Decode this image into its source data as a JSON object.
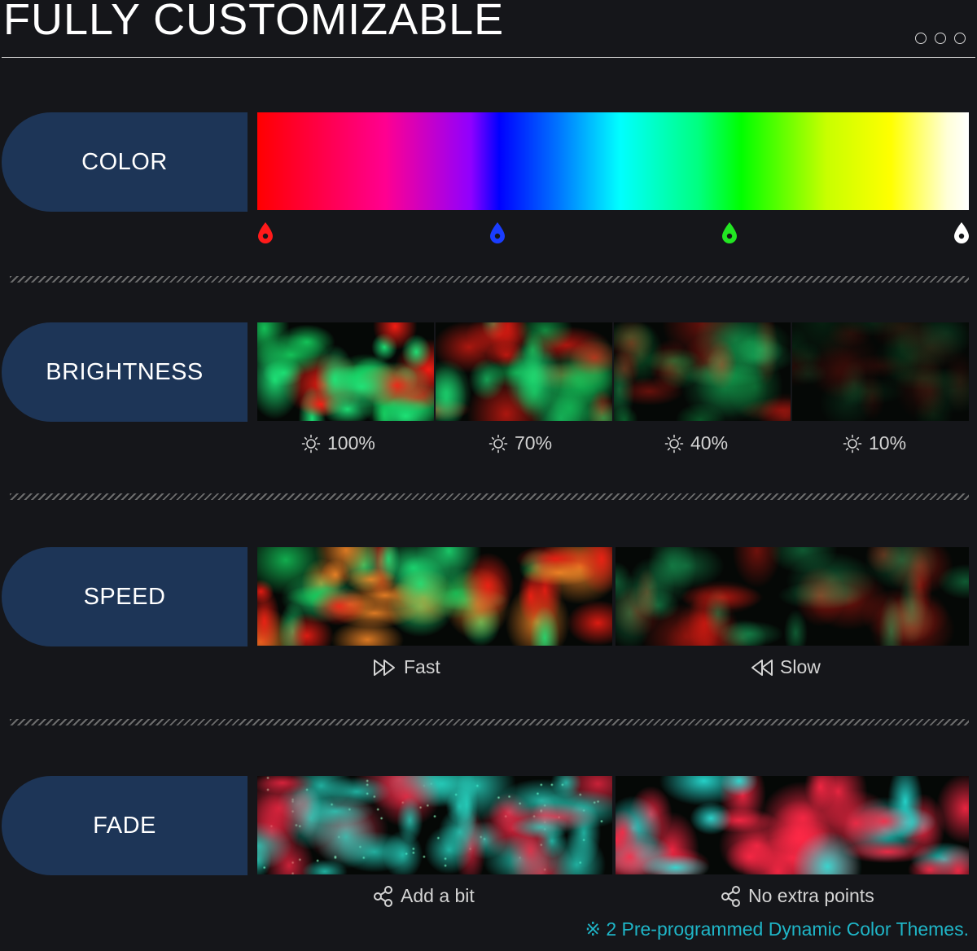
{
  "header": {
    "title": "FULLY CUSTOMIZABLE"
  },
  "sections": {
    "color": {
      "label": "COLOR",
      "drops": [
        {
          "color": "#ff1a1a"
        },
        {
          "color": "#1a3dff"
        },
        {
          "color": "#22e622"
        },
        {
          "color": "#ffffff"
        }
      ]
    },
    "brightness": {
      "label": "BRIGHTNESS",
      "levels": [
        {
          "label": "100%",
          "level": 1.0
        },
        {
          "label": "70%",
          "level": 0.7
        },
        {
          "label": "40%",
          "level": 0.4
        },
        {
          "label": "10%",
          "level": 0.1
        }
      ]
    },
    "speed": {
      "label": "SPEED",
      "options": [
        {
          "label": "Fast",
          "icon": "fast-forward-icon"
        },
        {
          "label": "Slow",
          "icon": "rewind-icon"
        }
      ]
    },
    "fade": {
      "label": "FADE",
      "options": [
        {
          "label": "Add a bit",
          "icon": "share-icon"
        },
        {
          "label": "No extra points",
          "icon": "share-icon"
        }
      ]
    }
  },
  "footnote": "※  2 Pre-programmed Dynamic Color Themes.",
  "colors": {
    "background": "#15161a",
    "pill": "#1d3557",
    "accent": "#1fb5c7"
  }
}
